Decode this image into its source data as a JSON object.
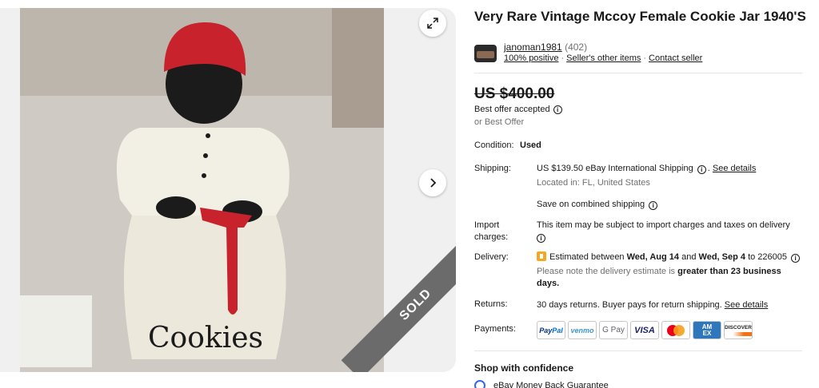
{
  "gallery": {
    "photo_alt": "Cookie jar photo",
    "photo_text": "Cookies",
    "sold_ribbon": "SOLD",
    "expand_icon": "expand-icon",
    "next_icon": "chevron-right-icon"
  },
  "listing": {
    "title": "Very Rare Vintage Mccoy Female Cookie Jar 1940'S"
  },
  "seller": {
    "name": "janoman1981",
    "feedback_count": "(402)",
    "positive": "100% positive",
    "other_items": "Seller's other items",
    "contact": "Contact seller"
  },
  "price": {
    "original": "US $400.00",
    "best_offer_accepted": "Best offer accepted",
    "or_best_offer": "or Best Offer"
  },
  "condition": {
    "label": "Condition:",
    "value": "Used"
  },
  "shipping": {
    "label": "Shipping:",
    "cost": "US $139.50 eBay International Shipping",
    "see_details": "See details",
    "located": "Located in: FL, United States",
    "combined": "Save on combined shipping"
  },
  "import": {
    "label_line1": "Import",
    "label_line2": "charges:",
    "text": "This item may be subject to import charges and taxes on delivery"
  },
  "delivery": {
    "label": "Delivery:",
    "estimated_prefix": "Estimated between",
    "date_start": "Wed, Aug 14",
    "and": "and",
    "date_end": "Wed, Sep 4",
    "to_zip": "to 226005",
    "note_prefix": "Please note the delivery estimate is",
    "note_bold": "greater than 23 business days."
  },
  "returns": {
    "label": "Returns:",
    "text": "30 days returns. Buyer pays for return shipping.",
    "see_details": "See details"
  },
  "payments": {
    "label": "Payments:",
    "methods": [
      "PayPal",
      "venmo",
      "G Pay",
      "VISA",
      "Mastercard",
      "AMEX",
      "DISCOVER"
    ]
  },
  "confidence": {
    "heading": "Shop with confidence",
    "item": "eBay Money Back Guarantee"
  },
  "colors": {
    "link_blue": "#3665f3",
    "sold_ribbon": "#6b6b6b",
    "text": "#191919",
    "muted": "#707070"
  }
}
